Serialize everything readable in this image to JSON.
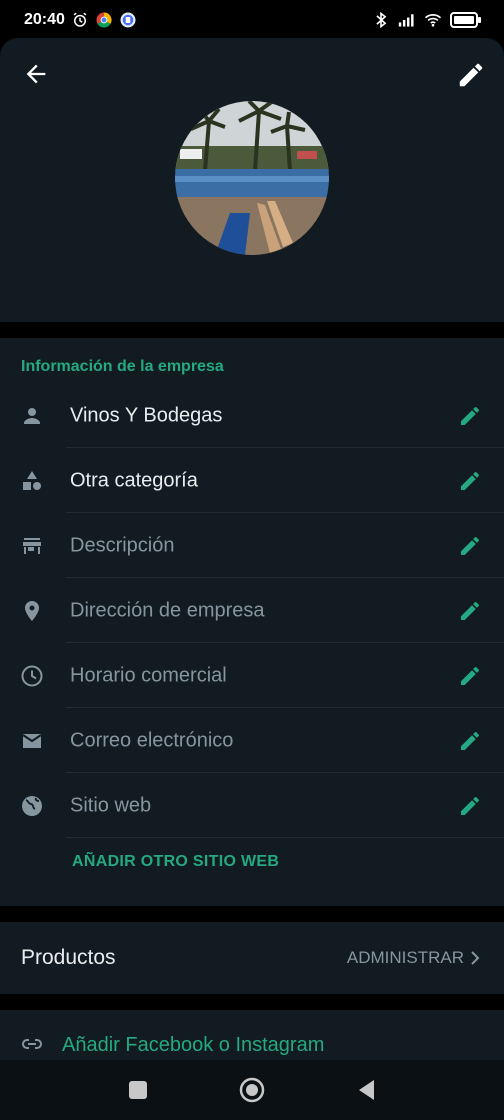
{
  "status": {
    "time": "20:40"
  },
  "header": {
    "back_icon": "arrow-back-icon",
    "edit_icon": "pencil-icon"
  },
  "business_info": {
    "section_title": "Información de la empresa",
    "rows": [
      {
        "label": "Vinos Y Bodegas",
        "icon": "person-icon",
        "filled": true
      },
      {
        "label": "Otra categoría",
        "icon": "category-shapes-icon",
        "filled": true
      },
      {
        "label": "Descripción",
        "icon": "store-icon",
        "filled": false
      },
      {
        "label": "Dirección de empresa",
        "icon": "location-pin-icon",
        "filled": false
      },
      {
        "label": "Horario comercial",
        "icon": "clock-icon",
        "filled": false
      },
      {
        "label": "Correo electrónico",
        "icon": "email-icon",
        "filled": false
      },
      {
        "label": "Sitio web",
        "icon": "globe-icon",
        "filled": false
      }
    ],
    "add_website": "AÑADIR OTRO SITIO WEB"
  },
  "products": {
    "title": "Productos",
    "manage": "ADMINISTRAR"
  },
  "social": {
    "label": "Añadir Facebook o Instagram"
  },
  "colors": {
    "accent": "#25a884",
    "background": "#111b21",
    "muted": "#8696a0"
  }
}
